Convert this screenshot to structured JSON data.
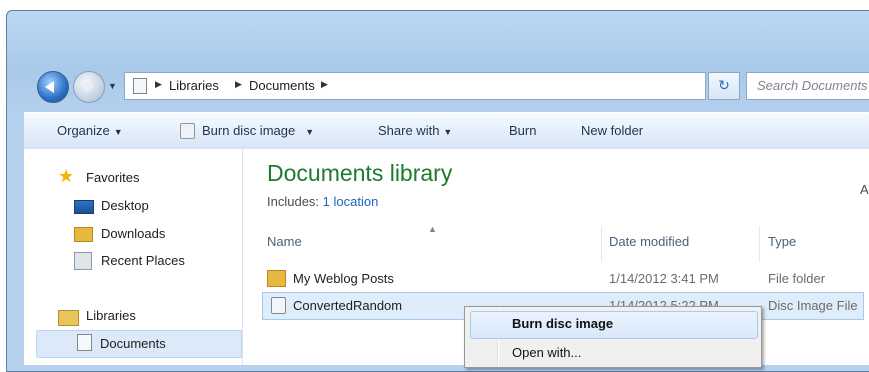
{
  "address": {
    "crumbs": [
      "Libraries",
      "Documents"
    ],
    "search_placeholder": "Search Documents"
  },
  "toolbar": {
    "organize": "Organize",
    "burn_disc_image": "Burn disc image",
    "share_with": "Share with",
    "burn": "Burn",
    "new_folder": "New folder"
  },
  "nav_pane": {
    "favorites": "Favorites",
    "desktop": "Desktop",
    "downloads": "Downloads",
    "recent_places": "Recent Places",
    "libraries": "Libraries",
    "documents": "Documents"
  },
  "library": {
    "title": "Documents library",
    "includes_label": "Includes:",
    "location_link": "1 location",
    "arrange_partial": "A"
  },
  "columns": {
    "name": "Name",
    "date_modified": "Date modified",
    "type": "Type"
  },
  "files": [
    {
      "name": "My Weblog Posts",
      "date": "1/14/2012 3:41 PM",
      "type": "File folder"
    },
    {
      "name": "ConvertedRandom",
      "date": "1/14/2012 5:22 PM",
      "type": "Disc Image File"
    }
  ],
  "context_menu": {
    "items": [
      "Burn disc image",
      "Open with..."
    ]
  },
  "colors": {
    "library_title": "#1d7a2e",
    "link": "#1c64c4",
    "selection": "#dfedfb"
  },
  "icons": [
    "back-icon",
    "forward-icon",
    "refresh-icon",
    "star-icon",
    "folder-icon",
    "disc-image-icon",
    "document-icon",
    "library-icon"
  ]
}
